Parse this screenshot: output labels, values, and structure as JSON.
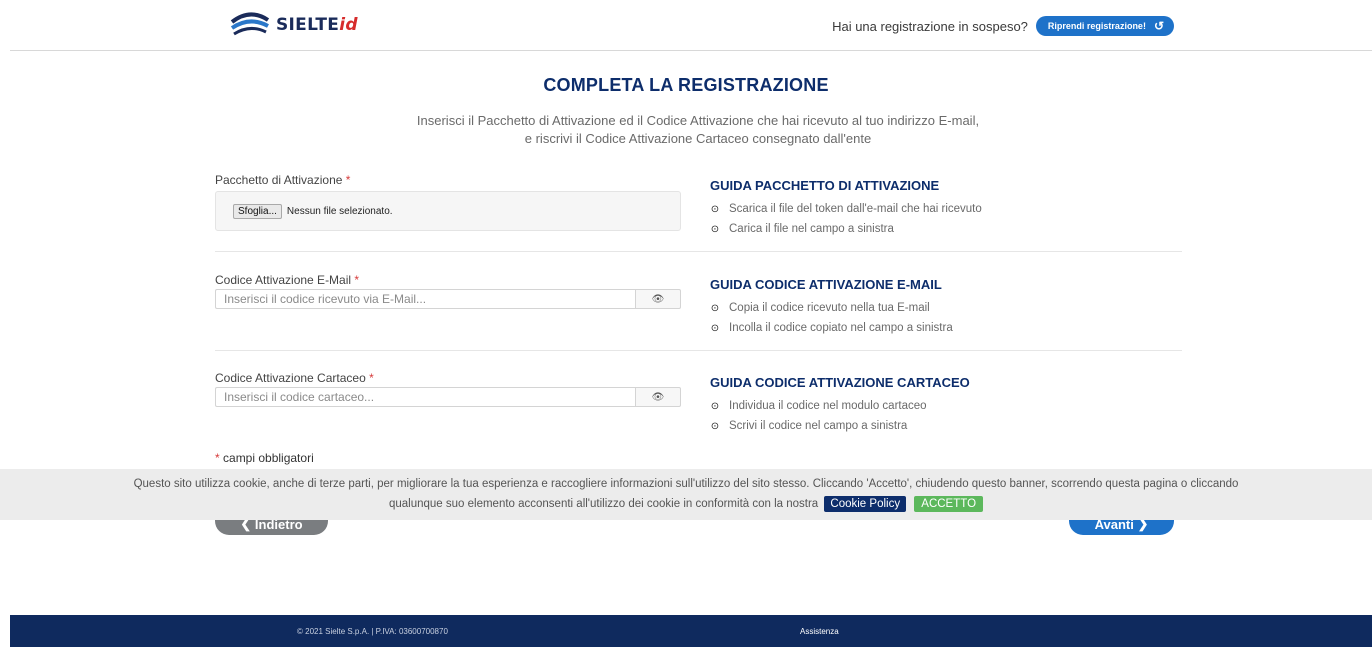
{
  "header": {
    "logo_text": "SIELTE",
    "logo_suffix": "id",
    "pending_text": "Hai una registrazione in sospeso?",
    "resume_label": "Riprendi registrazione!"
  },
  "main": {
    "title": "COMPLETA LA REGISTRAZIONE",
    "intro_line1": "Inserisci il Pacchetto di Attivazione ed il Codice Attivazione che hai ricevuto al tuo indirizzo E-mail,",
    "intro_line2": "e riscrivi il Codice Attivazione Cartaceo consegnato dall'ente"
  },
  "fields": {
    "package": {
      "label": "Pacchetto di Attivazione",
      "browse_label": "Sfoglia...",
      "file_status": "Nessun file selezionato.",
      "guide_title": "GUIDA PACCHETTO DI ATTIVAZIONE",
      "guide_items": [
        "Scarica il file del token dall'e-mail che hai ricevuto",
        "Carica il file nel campo a sinistra"
      ]
    },
    "email_code": {
      "label": "Codice Attivazione E-Mail",
      "placeholder": "Inserisci il codice ricevuto via E-Mail...",
      "guide_title": "GUIDA CODICE ATTIVAZIONE E-MAIL",
      "guide_items": [
        "Copia il codice ricevuto nella tua E-mail",
        "Incolla il codice copiato nel campo a sinistra"
      ]
    },
    "paper_code": {
      "label": "Codice Attivazione Cartaceo",
      "placeholder": "Inserisci il codice cartaceo...",
      "guide_title": "GUIDA CODICE ATTIVAZIONE CARTACEO",
      "guide_items": [
        "Individua il codice nel modulo cartaceo",
        "Scrivi il codice nel campo a sinistra"
      ]
    },
    "required_marker": "*",
    "required_note": "campi obbligatori"
  },
  "nav": {
    "back_label": "Indietro",
    "next_label": "Avanti"
  },
  "cookie": {
    "line1": "Questo sito utilizza cookie, anche di terze parti, per migliorare la tua esperienza e raccogliere informazioni sull'utilizzo del sito stesso. Cliccando 'Accetto', chiudendo questo banner, scorrendo questa pagina o cliccando",
    "line2": "qualunque suo elemento acconsenti all'utilizzo dei cookie in conformità con la nostra",
    "policy_label": "Cookie Policy",
    "accept_label": "ACCETTO"
  },
  "footer": {
    "copyright": "© 2021 Sielte S.p.A. | P.IVA: 03600700870",
    "assistance": "Assistenza"
  },
  "colors": {
    "brand_navy": "#0d2d6b",
    "accent_blue": "#1e72c9",
    "required_red": "#d63a3a",
    "accept_green": "#5cb85c"
  },
  "icons": [
    "logo-waves-icon",
    "refresh-icon",
    "eye-icon",
    "chevron-circle-icon",
    "chevron-left-icon",
    "chevron-right-icon"
  ]
}
